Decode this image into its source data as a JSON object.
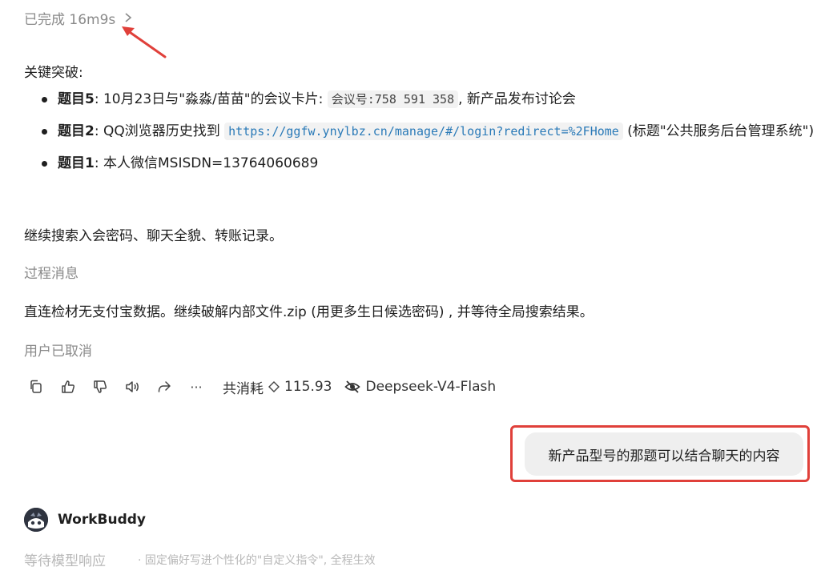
{
  "status": {
    "label": "已完成 16m9s"
  },
  "annotation": {
    "arrow_color": "#e0403a",
    "box_color": "#e0403a"
  },
  "message": {
    "heading": "关键突破:",
    "items": [
      {
        "title": "题目5",
        "sep": ":",
        "text_before": "10月23日与\"淼淼/苗苗\"的会议卡片: ",
        "code": "会议号:758 591 358",
        "text_after": ", 新产品发布讨论会"
      },
      {
        "title": "题目2",
        "sep": ":",
        "text_before": "QQ浏览器历史找到 ",
        "link": "https://ggfw.ynylbz.cn/manage/#/login?redirect=%2FHome",
        "text_after": " (标题\"公共服务后台管理系统\")"
      },
      {
        "title": "题目1",
        "sep": ":",
        "text": "本人微信MSISDN=13764060689"
      }
    ],
    "continue_text": "继续搜索入会密码、聊天全貌、转账记录。",
    "process_label": "过程消息",
    "process_text": "直连检材无支付宝数据。继续破解内部文件.zip (用更多生日候选密码) , 并等待全局搜索结果。",
    "cancelled_label": "用户已取消"
  },
  "toolbar": {
    "icons": [
      "copy-icon",
      "thumbs-up-icon",
      "thumbs-down-icon",
      "speaker-icon",
      "share-icon",
      "more-icon"
    ],
    "more_label": "···",
    "cost_label": "共消耗",
    "cost_value": "115.93",
    "model_name": "Deepseek-V4-Flash"
  },
  "user_message": {
    "text": "新产品型号的那题可以结合聊天的内容"
  },
  "bot": {
    "name": "WorkBuddy",
    "waiting_text": "等待模型响应",
    "tip_text": "· 固定偏好写进个性化的\"自定义指令\", 全程生效"
  }
}
